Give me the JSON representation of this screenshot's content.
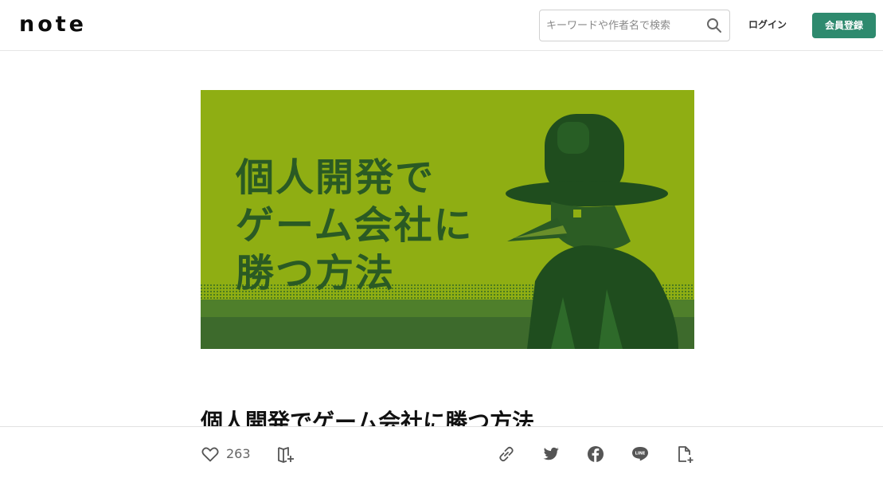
{
  "header": {
    "logo": "note",
    "search_placeholder": "キーワードや作者名で検索",
    "login_label": "ログイン",
    "signup_label": "会員登録"
  },
  "hero": {
    "title_lines": [
      "個人開発で",
      "ゲーム会社に",
      "勝つ方法"
    ]
  },
  "article": {
    "title": "個人開発でゲーム会社に勝つ方法"
  },
  "footer": {
    "like_count": "263",
    "icons": [
      "heart-icon",
      "magazine-add-icon",
      "link-icon",
      "twitter-icon",
      "facebook-icon",
      "line-icon",
      "embed-icon"
    ]
  },
  "colors": {
    "brand_green": "#2e8a6e",
    "hero_bg": "#8fae13",
    "hero_dark": "#2a5a24"
  }
}
